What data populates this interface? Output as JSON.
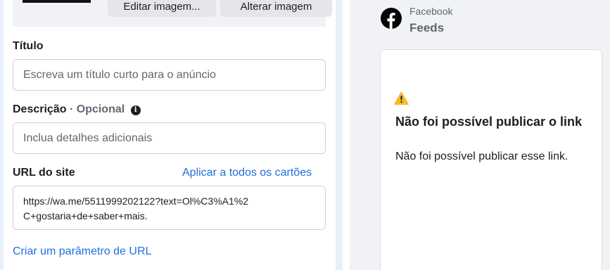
{
  "image_actions": {
    "edit_label": "Editar imagem...",
    "change_label": "Alterar imagem"
  },
  "title_field": {
    "label": "Título",
    "placeholder": "Escreva um título curto para o anúncio",
    "value": ""
  },
  "description_field": {
    "label": "Descrição",
    "optional": "· Opcional",
    "info_icon": "info-icon",
    "placeholder": "Inclua detalhes adicionais",
    "value": ""
  },
  "url_field": {
    "label": "URL do site",
    "apply_all_link": "Aplicar a todos os cartões",
    "value": "https://wa.me/5511999202122?text=Ol%C3%A1%2C+gostaria+de+saber+mais."
  },
  "url_param_link": "Criar um parâmetro de URL",
  "preview": {
    "platform_icon": "facebook-icon",
    "platform": "Facebook",
    "placement": "Feeds",
    "warning_icon": "warning-icon",
    "error_title": "Não foi possível publicar o link",
    "error_message": "Não foi possível publicar esse link."
  },
  "colors": {
    "link": "#216fdb",
    "warning": "#f7b928",
    "preview_bg": "#f0f2f5"
  }
}
